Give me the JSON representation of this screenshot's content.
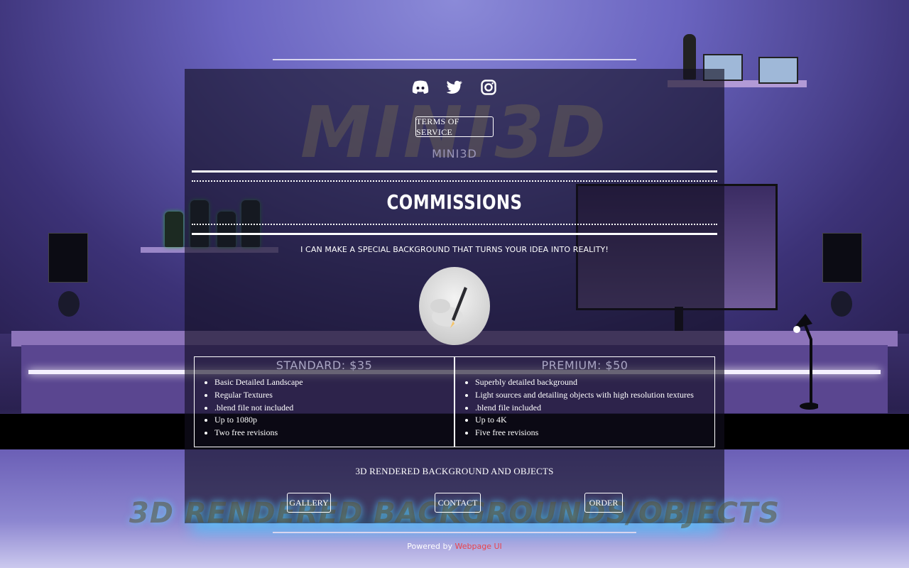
{
  "colors": {
    "accent_link": "#e8444e",
    "text": "#ffffff",
    "panel": "rgba(18,14,32,0.62)"
  },
  "social": [
    {
      "icon": "discord-icon"
    },
    {
      "icon": "twitter-icon"
    },
    {
      "icon": "instagram-icon"
    }
  ],
  "watermark": "MINI3D",
  "header": {
    "tos_label": "TERMS OF SERVICE",
    "brand": "MINI3D"
  },
  "main": {
    "title": "COMMISSIONS",
    "tagline": "I CAN MAKE A SPECIAL BACKGROUND THAT TURNS YOUR IDEA INTO REALITY!"
  },
  "tiers": [
    {
      "title": "STANDARD: $35",
      "features": [
        "Basic Detailed Landscape",
        "Regular Textures",
        ".blend file not included",
        "Up to 1080p",
        "Two free revisions"
      ]
    },
    {
      "title": "PREMIUM: $50",
      "features": [
        "Superbly detailed background",
        "Light sources and detailing objects with high resolution textures",
        ".blend file included",
        "Up to 4K",
        "Five free revisions"
      ]
    }
  ],
  "footer": {
    "heading": "3D RENDERED BACKGROUND AND OBJECTS",
    "nav": {
      "gallery": "GALLERY",
      "contact": "CONTACT",
      "order": "ORDER"
    },
    "big_text": "3D RENDERED BACKGROUNDS/OBJECTS",
    "powered_prefix": "Powered by",
    "powered_link": "Webpage UI"
  }
}
